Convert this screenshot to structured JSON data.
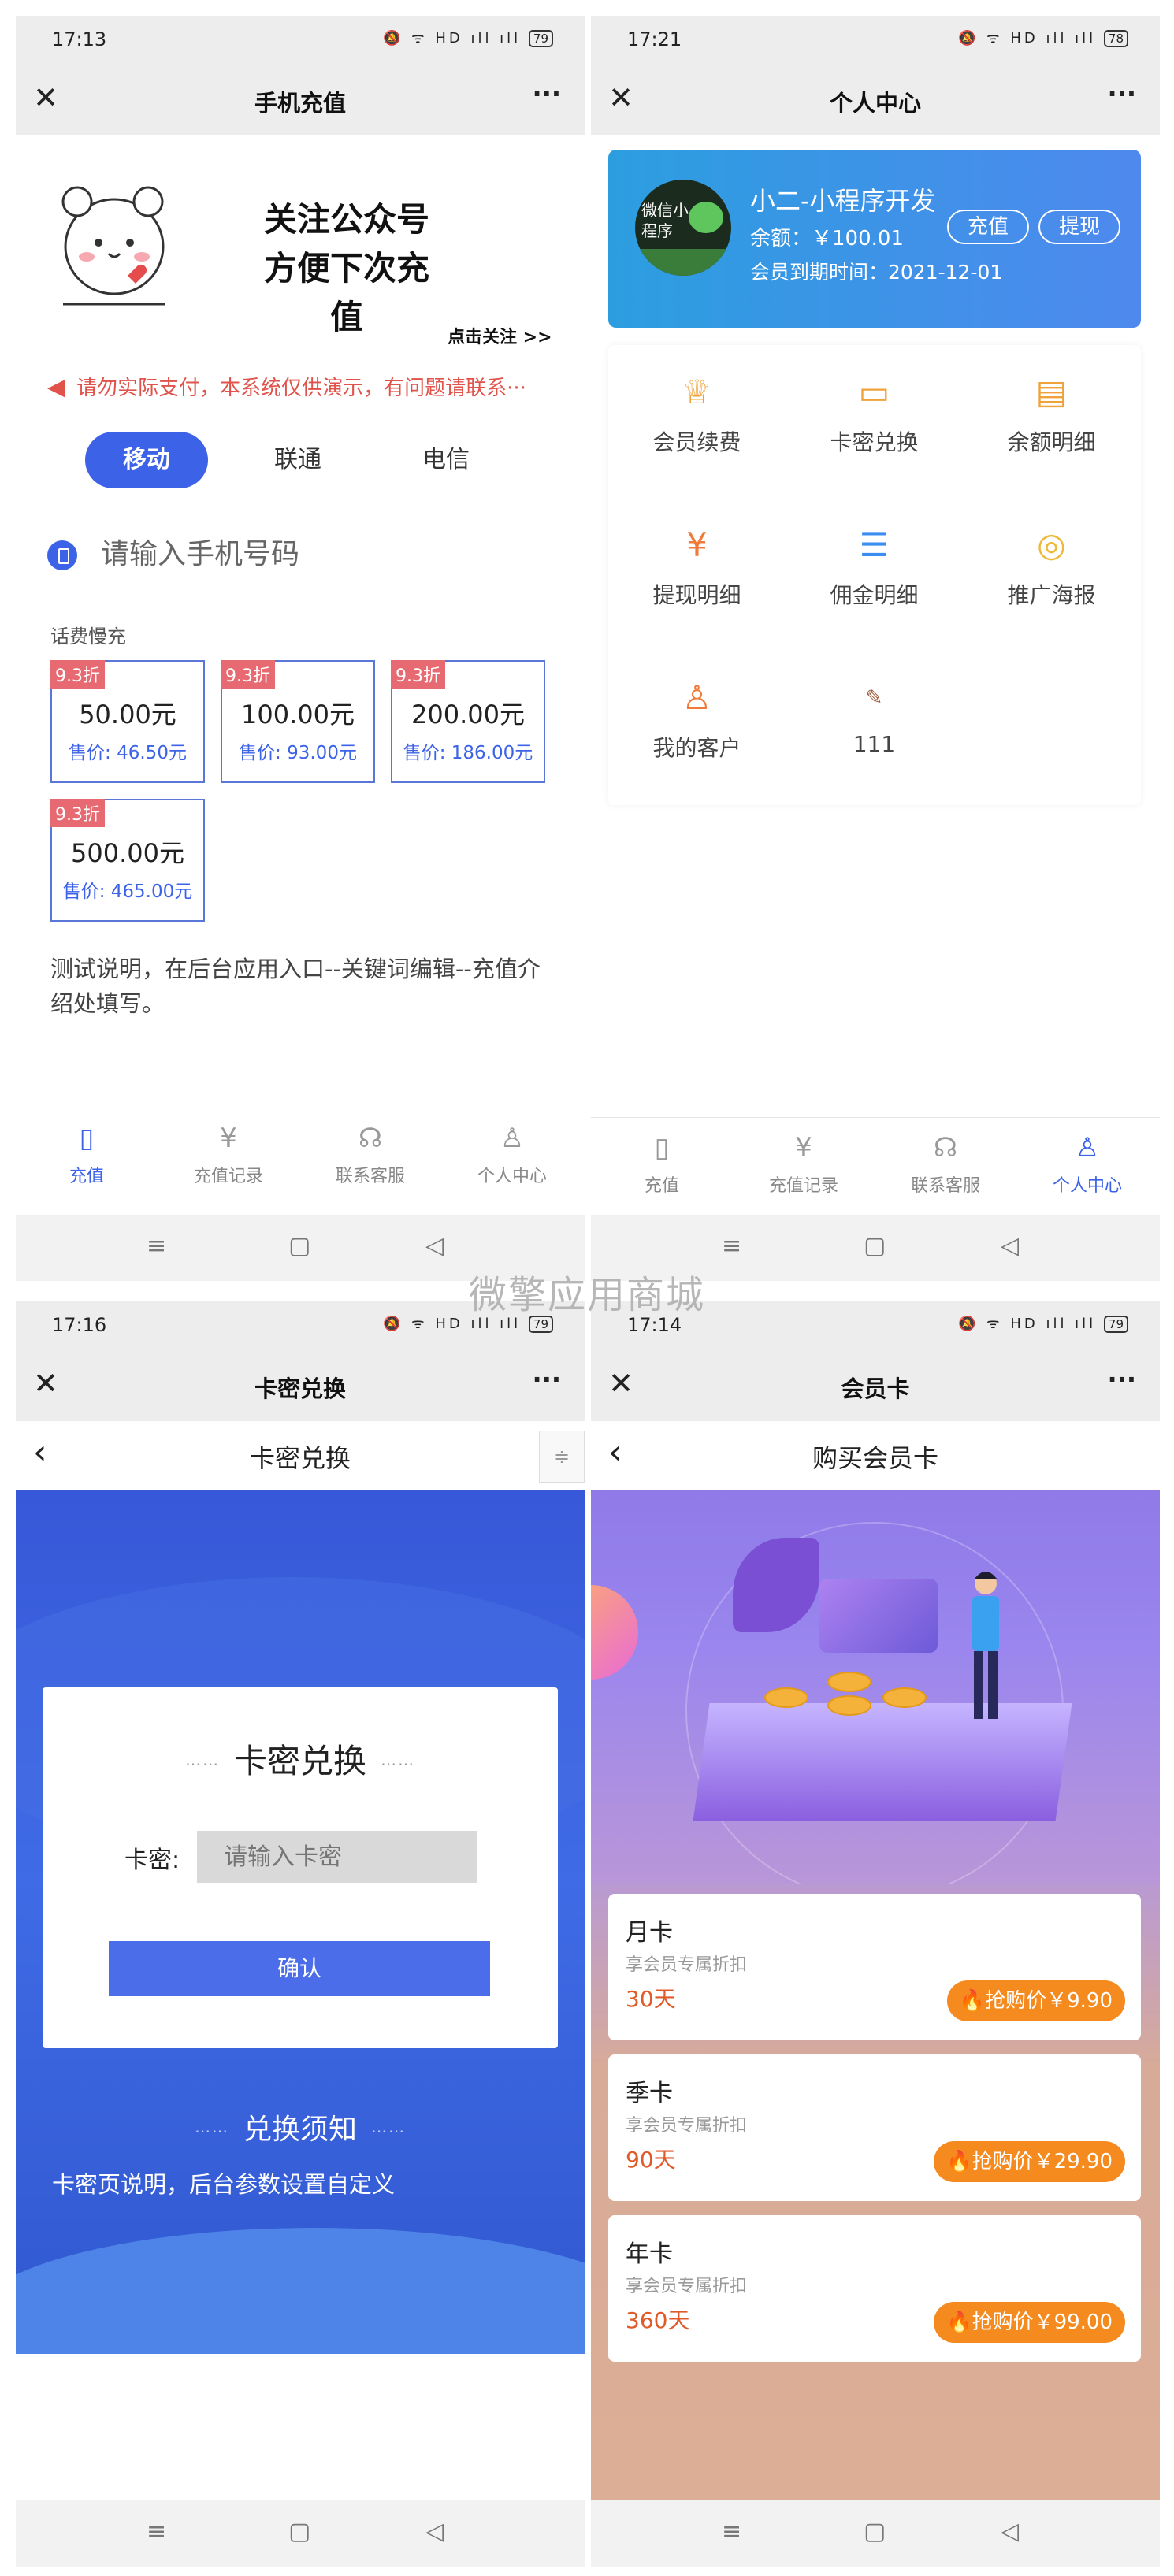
{
  "colors": {
    "accent": "#3c62e8",
    "badge": "#e76a72",
    "orange": "#f58a1f",
    "notice_red": "#e0524a"
  },
  "watermark": "微擎应用商城",
  "p1": {
    "status": {
      "time": "17:13",
      "battery": "79"
    },
    "title": "手机充值",
    "follow_line1": "关注公众号",
    "follow_line2": "方便下次充值",
    "follow_link": "点击关注 >>",
    "notice": "请勿实际支付，本系统仅供演示，有问题请联系···",
    "carriers": [
      "移动",
      "联通",
      "电信"
    ],
    "phone_placeholder": "请输入手机号码",
    "section": "话费慢充",
    "packages": [
      {
        "badge": "9.3折",
        "face": "50.00元",
        "price": "售价: 46.50元"
      },
      {
        "badge": "9.3折",
        "face": "100.00元",
        "price": "售价: 93.00元"
      },
      {
        "badge": "9.3折",
        "face": "200.00元",
        "price": "售价: 186.00元"
      },
      {
        "badge": "9.3折",
        "face": "500.00元",
        "price": "售价: 465.00元"
      }
    ],
    "desc": "测试说明，在后台应用入口--关键词编辑--充值介绍处填写。",
    "tabs": [
      "充值",
      "充值记录",
      "联系客服",
      "个人中心"
    ],
    "active_tab": "充值"
  },
  "p2": {
    "status": {
      "time": "17:21",
      "battery": "78"
    },
    "title": "个人中心",
    "avatar_text": "微信小程序",
    "username": "小二-小程序开发",
    "balance": "余额：￥100.01",
    "expire": "会员到期时间：2021-12-01",
    "btn_recharge": "充值",
    "btn_withdraw": "提现",
    "menu": [
      {
        "label": "会员续费",
        "icon": "crown-icon"
      },
      {
        "label": "卡密兑换",
        "icon": "card-icon"
      },
      {
        "label": "余额明细",
        "icon": "note-icon"
      },
      {
        "label": "提现明细",
        "icon": "yuan-doc-icon"
      },
      {
        "label": "佣金明细",
        "icon": "list-icon"
      },
      {
        "label": "推广海报",
        "icon": "poster-icon"
      },
      {
        "label": "我的客户",
        "icon": "user-icon"
      },
      {
        "label": "111",
        "icon": "custom-image-icon"
      }
    ],
    "tabs": [
      "充值",
      "充值记录",
      "联系客服",
      "个人中心"
    ],
    "active_tab": "个人中心"
  },
  "p3": {
    "status": {
      "time": "17:16",
      "battery": "79"
    },
    "title": "卡密兑换",
    "sub_title": "卡密兑换",
    "card_title": "卡密兑换",
    "label": "卡密:",
    "placeholder": "请输入卡密",
    "confirm": "确认",
    "notice_title": "兑换须知",
    "notice_desc": "卡密页说明，后台参数设置自定义"
  },
  "p4": {
    "status": {
      "time": "17:14",
      "battery": "79"
    },
    "title": "会员卡",
    "sub_title": "购买会员卡",
    "cards": [
      {
        "name": "月卡",
        "sub": "享会员专属折扣",
        "period": "30天",
        "buy": "抢购价￥9.90"
      },
      {
        "name": "季卡",
        "sub": "享会员专属折扣",
        "period": "90天",
        "buy": "抢购价￥29.90"
      },
      {
        "name": "年卡",
        "sub": "享会员专属折扣",
        "period": "360天",
        "buy": "抢购价￥99.00"
      }
    ]
  }
}
